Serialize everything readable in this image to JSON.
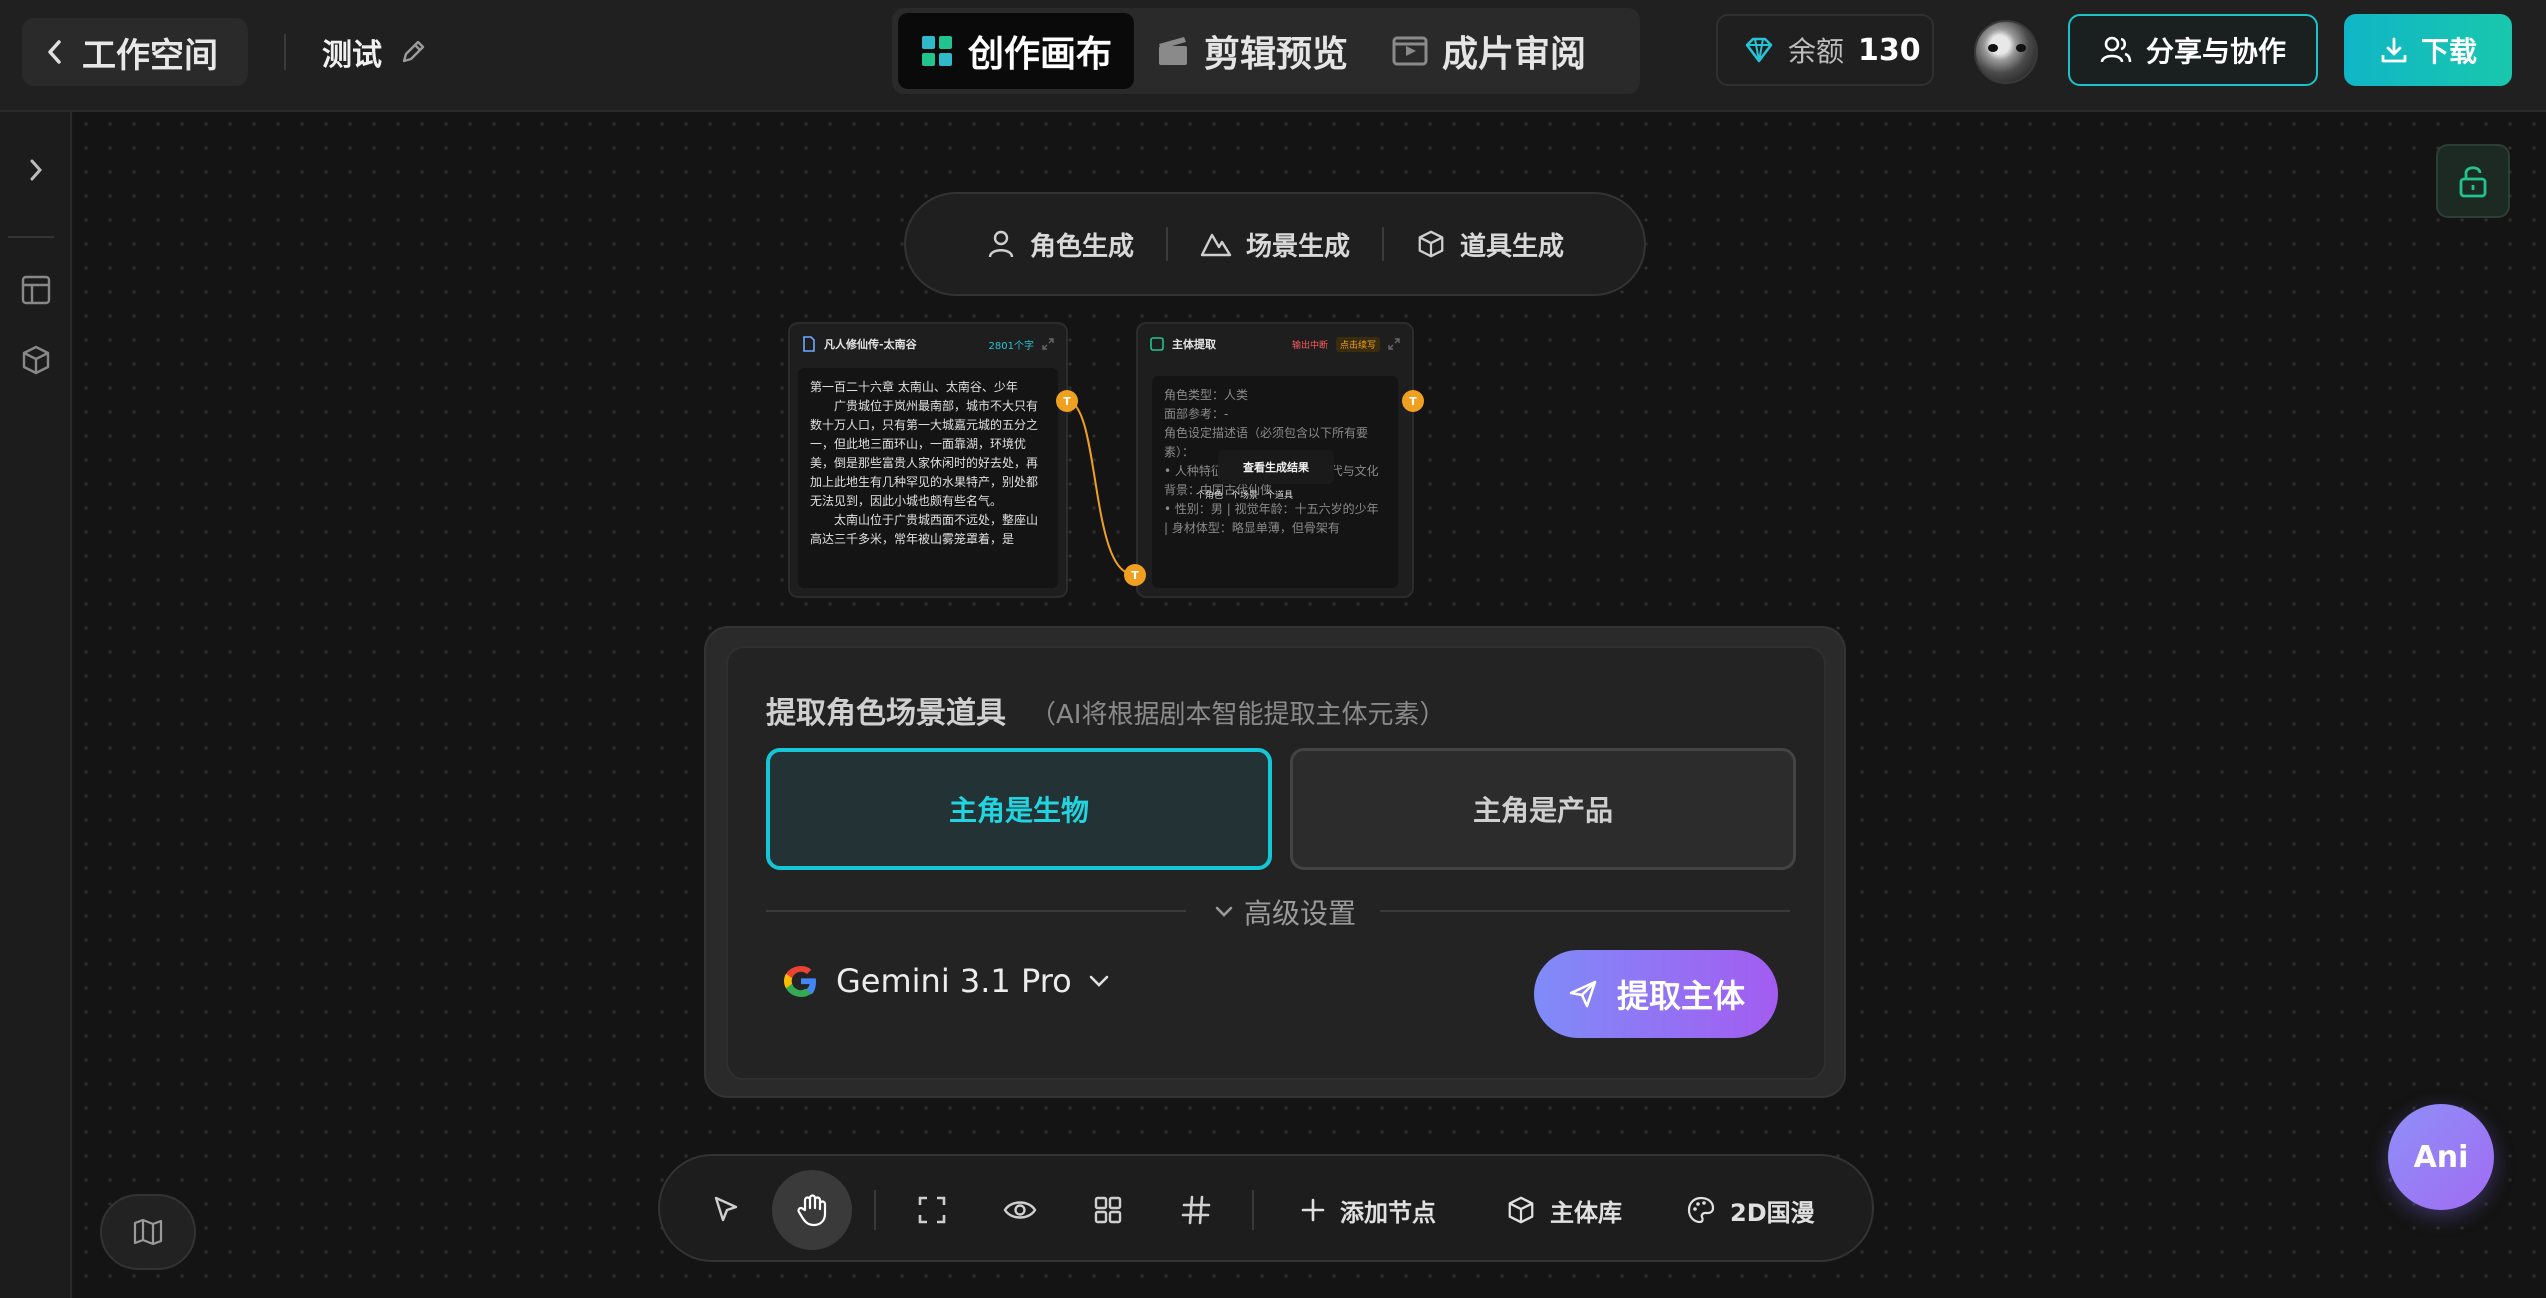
{
  "header": {
    "back_label": "工作空间",
    "project_name": "测试",
    "tabs": [
      {
        "label": "创作画布",
        "icon": "grid-icon",
        "active": true
      },
      {
        "label": "剪辑预览",
        "icon": "clapper-icon",
        "active": false
      },
      {
        "label": "成片审阅",
        "icon": "video-icon",
        "active": false
      }
    ],
    "balance_label": "余额",
    "balance_value": "130",
    "share_label": "分享与协作",
    "download_label": "下载"
  },
  "generate_bar": {
    "items": [
      {
        "label": "角色生成",
        "icon": "person-icon"
      },
      {
        "label": "场景生成",
        "icon": "mountain-icon"
      },
      {
        "label": "道具生成",
        "icon": "box-icon"
      }
    ]
  },
  "node_script": {
    "title": "凡人修仙传-太南谷",
    "count": "2801个字",
    "text": [
      "第一百二十六章 太南山、太南谷、少年",
      "　　广贵城位于岚州最南部，城市不大只有数十万人口，只有第一大城嘉元城的五分之一，但此地三面环山，一面靠湖，环境优美，倒是那些富贵人家休闲时的好去处，再加上此地生有几种罕见的水果特产，别处都无法见到，因此小城也颇有些名气。",
      "　　太南山位于广贵城西面不远处，整座山高达三千多米，常年被山雾笼罩着，是"
    ]
  },
  "node_extract": {
    "title": "主体提取",
    "badge_red": "输出中断",
    "badge_orange": "点击续写",
    "lines": [
      "角色类型：人类",
      "面部参考：-",
      "角色设定描述语（必须包含以下所有要素）：",
      "• 人种特征：东亚人种 | 所属年代与文化背景：中国古代仙侠",
      "• 性别：男 | 视觉年龄：十五六岁的少年 | 身材体型：略显单薄，但骨架有"
    ],
    "view_result": "查看生成结果",
    "stats": [
      "个角色",
      "个场景",
      "个道具"
    ]
  },
  "extract_panel": {
    "title": "提取角色场景道具",
    "subtitle": "（AI将根据剧本智能提取主体元素）",
    "option_creature": "主角是生物",
    "option_product": "主角是产品",
    "advanced": "高级设置",
    "model": "Gemini 3.1 Pro",
    "submit": "提取主体"
  },
  "toolbar": {
    "add_node": "添加节点",
    "subject_lib": "主体库",
    "style": "2D国漫"
  },
  "assistant": {
    "label": "Ani"
  },
  "colors": {
    "accent": "#15c6d6",
    "handle": "#f0a020",
    "purple": "#a35cf0"
  }
}
